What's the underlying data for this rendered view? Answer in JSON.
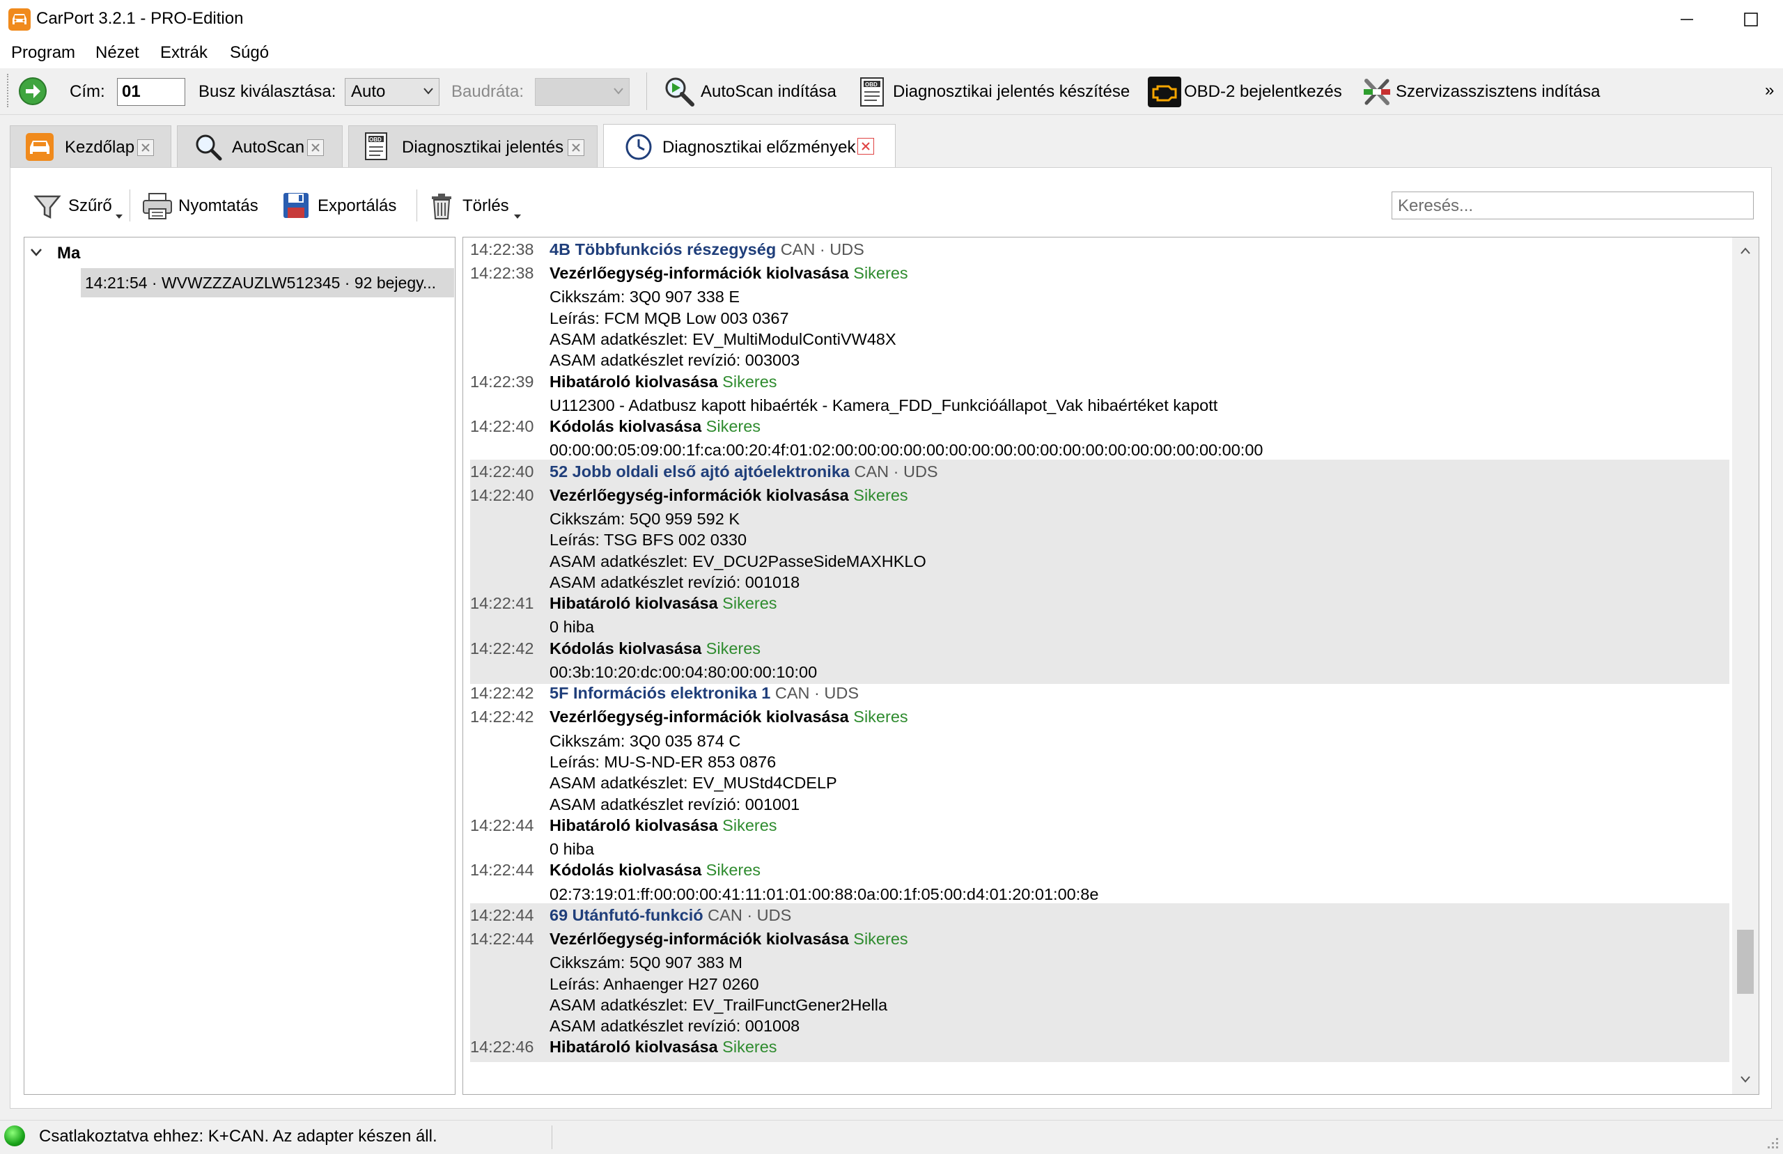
{
  "window": {
    "title": "CarPort 3.2.1 - PRO-Edition"
  },
  "menu": [
    "Program",
    "Nézet",
    "Extrák",
    "Súgó"
  ],
  "toolbar": {
    "address_label": "Cím:",
    "address_value": "01",
    "bus_label": "Busz kiválasztása:",
    "bus_value": "Auto",
    "baud_label": "Baudráta:",
    "baud_value": "",
    "autoscan": "AutoScan indítása",
    "report": "Diagnosztikai jelentés készítése",
    "obd": "OBD-2 bejelentkezés",
    "service": "Szervizasszisztens indítása",
    "overflow": "»"
  },
  "tabs": [
    {
      "label": "Kezdőlap",
      "icon": "car-icon"
    },
    {
      "label": "AutoScan",
      "icon": "magnifier-icon"
    },
    {
      "label": "Diagnosztikai jelentés",
      "icon": "obd-document-icon"
    },
    {
      "label": "Diagnosztikai előzmények",
      "icon": "clock-icon",
      "active": true
    }
  ],
  "actions": {
    "filter": "Szűrő",
    "print": "Nyomtatás",
    "export": "Exportálás",
    "delete": "Törlés",
    "search_placeholder": "Keresés..."
  },
  "tree": {
    "group": "Ma",
    "item": "14:21:54 · WVWZZZAUZLW512345 · 92 bejegy..."
  },
  "log": {
    "rows": [
      {
        "time": "14:22:38",
        "head": "4B Többfunkciós részegység",
        "meta": "CAN · UDS"
      },
      {
        "time": "14:22:38",
        "op": "Vezérlőegység-információk kiolvasása",
        "status": "Sikeres"
      },
      {
        "text": "Cikkszám: 3Q0 907 338 E"
      },
      {
        "text": "Leírás: FCM MQB Low 003 0367"
      },
      {
        "text": "ASAM adatkészlet: EV_MultiModulContiVW48X"
      },
      {
        "text": "ASAM adatkészlet revízió: 003003"
      },
      {
        "time": "14:22:39",
        "op": "Hibatároló kiolvasása",
        "status": "Sikeres"
      },
      {
        "text": "U112300 - Adatbusz kapott hibaérték - Kamera_FDD_Funkcióállapot_Vak hibaértéket kapott"
      },
      {
        "time": "14:22:40",
        "op": "Kódolás kiolvasása",
        "status": "Sikeres"
      },
      {
        "text": "00:00:00:05:09:00:1f:ca:00:20:4f:01:02:00:00:00:00:00:00:00:00:00:00:00:00:00:00:00:00:00:00:00"
      },
      {
        "time": "14:22:40",
        "head": "52 Jobb oldali első ajtó ajtóelektronika",
        "meta": "CAN · UDS"
      },
      {
        "time": "14:22:40",
        "op": "Vezérlőegység-információk kiolvasása",
        "status": "Sikeres"
      },
      {
        "text": "Cikkszám: 5Q0 959 592 K"
      },
      {
        "text": "Leírás: TSG BFS 002 0330"
      },
      {
        "text": "ASAM adatkészlet: EV_DCU2PasseSideMAXHKLO"
      },
      {
        "text": "ASAM adatkészlet revízió: 001018"
      },
      {
        "time": "14:22:41",
        "op": "Hibatároló kiolvasása",
        "status": "Sikeres"
      },
      {
        "text": "0 hiba"
      },
      {
        "time": "14:22:42",
        "op": "Kódolás kiolvasása",
        "status": "Sikeres"
      },
      {
        "text": "00:3b:10:20:dc:00:04:80:00:00:10:00"
      },
      {
        "time": "14:22:42",
        "head": "5F Információs elektronika 1",
        "meta": "CAN · UDS"
      },
      {
        "time": "14:22:42",
        "op": "Vezérlőegység-információk kiolvasása",
        "status": "Sikeres"
      },
      {
        "text": "Cikkszám: 3Q0 035 874 C"
      },
      {
        "text": "Leírás: MU-S-ND-ER 853 0876"
      },
      {
        "text": "ASAM adatkészlet: EV_MUStd4CDELP"
      },
      {
        "text": "ASAM adatkészlet revízió: 001001"
      },
      {
        "time": "14:22:44",
        "op": "Hibatároló kiolvasása",
        "status": "Sikeres"
      },
      {
        "text": "0 hiba"
      },
      {
        "time": "14:22:44",
        "op": "Kódolás kiolvasása",
        "status": "Sikeres"
      },
      {
        "text": "02:73:19:01:ff:00:00:00:41:11:01:01:00:88:0a:00:1f:05:00:d4:01:20:01:00:8e"
      },
      {
        "time": "14:22:44",
        "head": "69 Utánfutó-funkció",
        "meta": "CAN · UDS"
      },
      {
        "time": "14:22:44",
        "op": "Vezérlőegység-információk kiolvasása",
        "status": "Sikeres"
      },
      {
        "text": "Cikkszám: 5Q0 907 383 M"
      },
      {
        "text": "Leírás: Anhaenger H27 0260"
      },
      {
        "text": "ASAM adatkészlet: EV_TrailFunctGener2Hella"
      },
      {
        "text": "ASAM adatkészlet revízió: 001008"
      },
      {
        "time": "14:22:46",
        "op": "Hibatároló kiolvasása",
        "status": "Sikeres"
      }
    ]
  },
  "status": {
    "text": "Csatlakoztatva ehhez: K+CAN. Az adapter készen áll."
  },
  "colors": {
    "accent_green": "#2e8b2e",
    "header_blue": "#1f3e7a",
    "brand_orange": "#f08a1c"
  }
}
